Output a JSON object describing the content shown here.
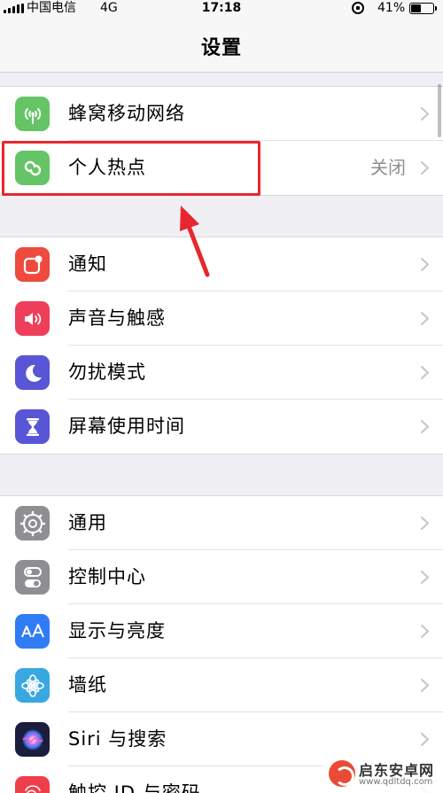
{
  "status_bar": {
    "carrier": "中国电信",
    "network": "4G",
    "time": "17:18",
    "battery": "41%",
    "battery_level": 0.41
  },
  "nav": {
    "title": "设置"
  },
  "groups": [
    {
      "items": [
        {
          "label": "蜂窝移动网络",
          "value": "",
          "icon": "cellular-antenna-icon",
          "color": "#65c466"
        },
        {
          "label": "个人热点",
          "value": "关闭",
          "icon": "personal-hotspot-icon",
          "color": "#65c466"
        }
      ]
    },
    {
      "items": [
        {
          "label": "通知",
          "value": "",
          "icon": "notifications-icon",
          "color": "#ee4a3e"
        },
        {
          "label": "声音与触感",
          "value": "",
          "icon": "speaker-icon",
          "color": "#ee3e5a"
        },
        {
          "label": "勿扰模式",
          "value": "",
          "icon": "moon-icon",
          "color": "#5856d6"
        },
        {
          "label": "屏幕使用时间",
          "value": "",
          "icon": "hourglass-icon",
          "color": "#5856d6"
        }
      ]
    },
    {
      "items": [
        {
          "label": "通用",
          "value": "",
          "icon": "gear-icon",
          "color": "#8e8e93"
        },
        {
          "label": "控制中心",
          "value": "",
          "icon": "switches-icon",
          "color": "#8e8e93"
        },
        {
          "label": "显示与亮度",
          "value": "",
          "icon": "text-size-icon",
          "color": "#2f7cf6"
        },
        {
          "label": "墙纸",
          "value": "",
          "icon": "flower-icon",
          "color": "#3aa8e0"
        },
        {
          "label": "Siri 与搜索",
          "value": "",
          "icon": "siri-icon",
          "color": "#1c1c3c"
        },
        {
          "label": "触控 ID 与密码",
          "value": "",
          "icon": "fingerprint-icon",
          "color": "#ee3e4a"
        }
      ]
    }
  ],
  "watermark": {
    "title": "启东安卓网",
    "url": "www.qdltdq.com"
  }
}
